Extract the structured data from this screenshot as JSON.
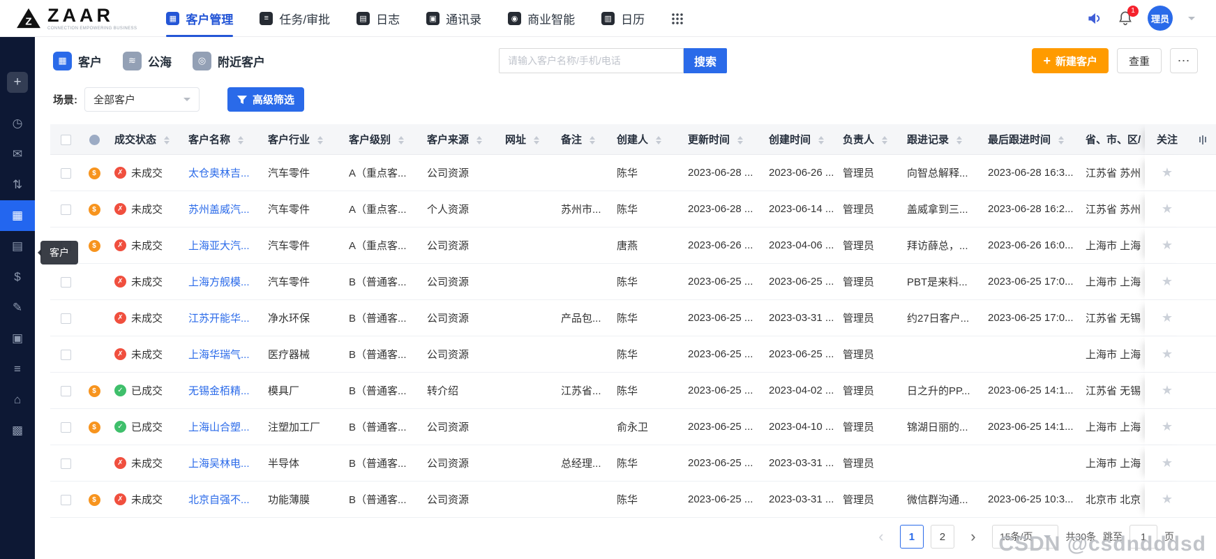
{
  "colors": {
    "accent_blue": "#2a6ae9",
    "nav_blue": "#2456d6",
    "orange": "#ff9b00",
    "sidebar_bg": "#0d1834",
    "error_red": "#f04f3e",
    "success_green": "#3fbf6b",
    "money_orange": "#f7941e"
  },
  "navbar": {
    "logo": "ZAAR",
    "logo_sub": "CONNECTION EMPOWERING BUSINESS",
    "items": [
      {
        "label": "客户管理",
        "icon": "▦",
        "active": true
      },
      {
        "label": "任务/审批",
        "icon": "≡",
        "active": false
      },
      {
        "label": "日志",
        "icon": "▤",
        "active": false
      },
      {
        "label": "通讯录",
        "icon": "▣",
        "active": false
      },
      {
        "label": "商业智能",
        "icon": "◉",
        "active": false
      },
      {
        "label": "日历",
        "icon": "▥",
        "active": false
      }
    ],
    "badge": "1",
    "avatar": "理员"
  },
  "sidebar": {
    "plus_icon": "+",
    "tooltip": "客户",
    "items": [
      {
        "name": "dashboard",
        "icon": "◷",
        "active": false
      },
      {
        "name": "messages",
        "icon": "✉",
        "active": false
      },
      {
        "name": "stats",
        "icon": "⇅",
        "active": false
      },
      {
        "name": "customers",
        "icon": "▦",
        "active": true
      },
      {
        "name": "documents",
        "icon": "▤",
        "active": false
      },
      {
        "name": "finance",
        "icon": "$",
        "active": false
      },
      {
        "name": "forms",
        "icon": "✎",
        "active": false
      },
      {
        "name": "products",
        "icon": "▣",
        "active": false
      },
      {
        "name": "lists",
        "icon": "≡",
        "active": false
      },
      {
        "name": "home",
        "icon": "⌂",
        "active": false
      },
      {
        "name": "apps",
        "icon": "▩",
        "active": false
      }
    ]
  },
  "toolbar": {
    "tabs": [
      {
        "label": "客户",
        "icon": "▦",
        "active": true
      },
      {
        "label": "公海",
        "icon": "≋",
        "active": false
      },
      {
        "label": "附近客户",
        "icon": "◎",
        "active": false
      }
    ],
    "search_placeholder": "请输入客户名称/手机/电话",
    "search_button": "搜索",
    "plus": "+",
    "new_customer_button": "新建客户",
    "dedupe_button": "查重",
    "more_button": "⋯",
    "scene_label": "场景:",
    "scene_value": "全部客户",
    "advanced_filter_button": "高级筛选"
  },
  "table": {
    "columns": [
      {
        "key": "status",
        "label": "成交状态"
      },
      {
        "key": "name",
        "label": "客户名称"
      },
      {
        "key": "industry",
        "label": "客户行业"
      },
      {
        "key": "level",
        "label": "客户级别"
      },
      {
        "key": "source",
        "label": "客户来源"
      },
      {
        "key": "website",
        "label": "网址"
      },
      {
        "key": "remark",
        "label": "备注"
      },
      {
        "key": "creator",
        "label": "创建人"
      },
      {
        "key": "updated",
        "label": "更新时间"
      },
      {
        "key": "created",
        "label": "创建时间"
      },
      {
        "key": "owner",
        "label": "负责人"
      },
      {
        "key": "followup",
        "label": "跟进记录"
      },
      {
        "key": "last_followed",
        "label": "最后跟进时间"
      },
      {
        "key": "region",
        "label": "省、市、区/"
      }
    ],
    "follow_column": "关注",
    "rows": [
      {
        "money": true,
        "closed": false,
        "status": "未成交",
        "name": "太仓奥林吉...",
        "industry": "汽车零件",
        "level": "A（重点客...",
        "source": "公司资源",
        "website": "",
        "remark": "",
        "creator": "陈华",
        "updated": "2023-06-28 ...",
        "created": "2023-06-26 ...",
        "owner": "管理员",
        "followup": "向智总解释...",
        "last_followed": "2023-06-28 16:3...",
        "region": "江苏省 苏州"
      },
      {
        "money": true,
        "closed": false,
        "status": "未成交",
        "name": "苏州盖威汽...",
        "industry": "汽车零件",
        "level": "A（重点客...",
        "source": "个人资源",
        "website": "",
        "remark": "苏州市...",
        "creator": "陈华",
        "updated": "2023-06-28 ...",
        "created": "2023-06-14 ...",
        "owner": "管理员",
        "followup": "盖威拿到三...",
        "last_followed": "2023-06-28 16:2...",
        "region": "江苏省 苏州"
      },
      {
        "money": true,
        "closed": false,
        "status": "未成交",
        "name": "上海亚大汽...",
        "industry": "汽车零件",
        "level": "A（重点客...",
        "source": "公司资源",
        "website": "",
        "remark": "",
        "creator": "唐燕",
        "updated": "2023-06-26 ...",
        "created": "2023-04-06 ...",
        "owner": "管理员",
        "followup": "拜访薛总，...",
        "last_followed": "2023-06-26 16:0...",
        "region": "上海市 上海"
      },
      {
        "money": false,
        "closed": false,
        "status": "未成交",
        "name": "上海方舰模...",
        "industry": "汽车零件",
        "level": "B（普通客...",
        "source": "公司资源",
        "website": "",
        "remark": "",
        "creator": "陈华",
        "updated": "2023-06-25 ...",
        "created": "2023-06-25 ...",
        "owner": "管理员",
        "followup": "PBT是来料...",
        "last_followed": "2023-06-25 17:0...",
        "region": "上海市 上海"
      },
      {
        "money": false,
        "closed": false,
        "status": "未成交",
        "name": "江苏开能华...",
        "industry": "净水环保",
        "level": "B（普通客...",
        "source": "公司资源",
        "website": "",
        "remark": "产品包...",
        "creator": "陈华",
        "updated": "2023-06-25 ...",
        "created": "2023-03-31 ...",
        "owner": "管理员",
        "followup": "约27日客户...",
        "last_followed": "2023-06-25 17:0...",
        "region": "江苏省 无锡"
      },
      {
        "money": false,
        "closed": false,
        "status": "未成交",
        "name": "上海华瑞气...",
        "industry": "医疗器械",
        "level": "B（普通客...",
        "source": "公司资源",
        "website": "",
        "remark": "",
        "creator": "陈华",
        "updated": "2023-06-25 ...",
        "created": "2023-06-25 ...",
        "owner": "管理员",
        "followup": "",
        "last_followed": "",
        "region": "上海市 上海"
      },
      {
        "money": true,
        "closed": true,
        "status": "已成交",
        "name": "无锡金栢精...",
        "industry": "模具厂",
        "level": "B（普通客...",
        "source": "转介绍",
        "website": "",
        "remark": "江苏省...",
        "creator": "陈华",
        "updated": "2023-06-25 ...",
        "created": "2023-04-02 ...",
        "owner": "管理员",
        "followup": "日之升的PP...",
        "last_followed": "2023-06-25 14:1...",
        "region": "江苏省 无锡"
      },
      {
        "money": true,
        "closed": true,
        "status": "已成交",
        "name": "上海山合塑...",
        "industry": "注塑加工厂",
        "level": "B（普通客...",
        "source": "公司资源",
        "website": "",
        "remark": "",
        "creator": "俞永卫",
        "updated": "2023-06-25 ...",
        "created": "2023-04-10 ...",
        "owner": "管理员",
        "followup": "锦湖日丽的...",
        "last_followed": "2023-06-25 14:1...",
        "region": "上海市 上海"
      },
      {
        "money": false,
        "closed": false,
        "status": "未成交",
        "name": "上海吴林电...",
        "industry": "半导体",
        "level": "B（普通客...",
        "source": "公司资源",
        "website": "",
        "remark": "总经理...",
        "creator": "陈华",
        "updated": "2023-06-25 ...",
        "created": "2023-03-31 ...",
        "owner": "管理员",
        "followup": "",
        "last_followed": "",
        "region": "上海市 上海"
      },
      {
        "money": true,
        "closed": false,
        "status": "未成交",
        "name": "北京自强不...",
        "industry": "功能薄膜",
        "level": "B（普通客...",
        "source": "公司资源",
        "website": "",
        "remark": "",
        "creator": "陈华",
        "updated": "2023-06-25 ...",
        "created": "2023-03-31 ...",
        "owner": "管理员",
        "followup": "微信群沟通...",
        "last_followed": "2023-06-25 10:3...",
        "region": "北京市 北京"
      }
    ]
  },
  "pagination": {
    "prev": "‹",
    "next": "›",
    "pages": [
      "1",
      "2"
    ],
    "active_page": "1",
    "page_size": "15条/页",
    "total": "共30条",
    "jump_label": "跳至",
    "jump_value": "1",
    "jump_suffix": "页"
  },
  "watermark": "CSDN @csdndddsd"
}
